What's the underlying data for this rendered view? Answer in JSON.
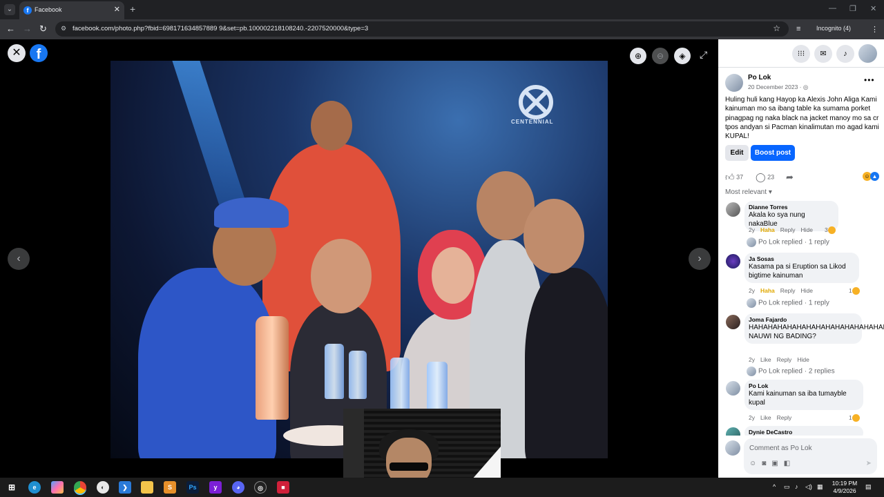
{
  "browser": {
    "tab_title": "Facebook",
    "tab_favicon": "f",
    "url": "facebook.com/photo.php?fbid=698171634857889 9&set=pb.100002218108240.-2207520000&type=3",
    "incognito_label": "Incognito (4)"
  },
  "viewer": {
    "logo_letter": "f",
    "sign_text": "CENTENNIAL"
  },
  "post": {
    "author": "Po Lok",
    "date": "20 December 2023 · ",
    "text": "Huling huli kang Hayop ka Alexis John Aliga Kami kainuman mo sa ibang table ka sumama porket pinagpag ng naka black na jacket manoy mo sa cr tpos andyan si Pacman kinalimutan mo agad kami KUPAL!",
    "edit_label": "Edit",
    "boost_label": "Boost post",
    "like_count": "37",
    "comment_count": "23",
    "sort_label": "Most relevant"
  },
  "comments": [
    {
      "name": "Dianne Torres",
      "text": "Akala ko sya nung nakaBlue",
      "time": "2y",
      "reaction": "Haha",
      "reply": "Reply",
      "hide": "Hide",
      "react_count": "3",
      "replied": "Po Lok replied · 1 reply"
    },
    {
      "name": "Ja Sosas",
      "text": "Kasama pa si Eruption sa Likod bigtime kainuman",
      "time": "2y",
      "reaction": "Haha",
      "reply": "Reply",
      "hide": "Hide",
      "react_count": "1",
      "replied": "Po Lok replied · 1 reply"
    },
    {
      "name": "Joma Fajardo",
      "text": "HAHAHAHAHAHAHAHAHAHAHAHAHAHAHAHAHAHA NAUWI NG BADING?",
      "time": "2y",
      "reaction": "Like",
      "reply": "Reply",
      "hide": "Hide",
      "react_count": "",
      "replied": "Po Lok replied · 2 replies"
    },
    {
      "name": "Po Lok",
      "text": "Kami kainuman sa iba tumayble kupal",
      "time": "2y",
      "reaction": "Like",
      "reply": "Reply",
      "hide": "",
      "react_count": "1",
      "replied": ""
    },
    {
      "name": "Dynie DeCastro",
      "text": ""
    }
  ],
  "comment_box": {
    "placeholder": "Comment as Po Lok"
  },
  "taskbar": {
    "time": "10:19 PM",
    "date": "4/9/2026",
    "apps": [
      "edge",
      "copilot",
      "chrome",
      "app",
      "vscode",
      "explorer",
      "sublime",
      "photoshop",
      "yahoo",
      "discord",
      "obs",
      "app2"
    ]
  },
  "colors": {
    "fb_blue": "#1877f2",
    "boost_blue": "#0866ff"
  }
}
